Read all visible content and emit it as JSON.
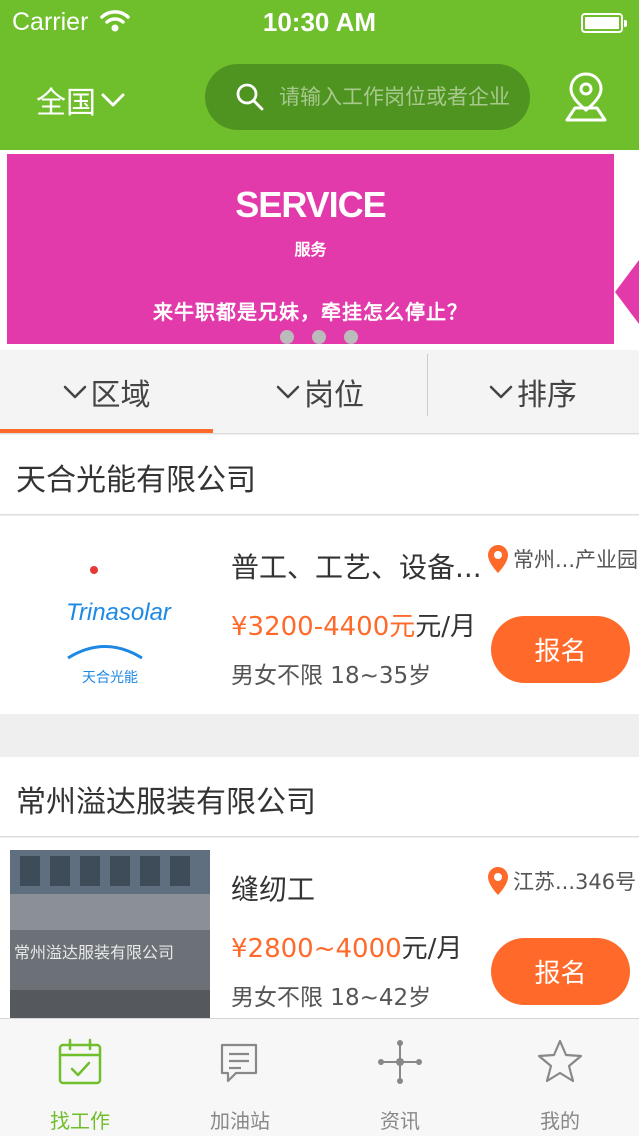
{
  "status_bar": {
    "carrier": "Carrier",
    "time": "10:30 AM"
  },
  "nav": {
    "region": "全国",
    "search_placeholder": "请输入工作岗位或者企业",
    "location_icon": "map-pin-icon"
  },
  "banner": {
    "title": "SERVICE",
    "subtitle": "服务",
    "slogan": "来牛职都是兄妹，牵挂怎么停止？",
    "color": "#e23aaa"
  },
  "filters": [
    {
      "label": "区域",
      "active": true
    },
    {
      "label": "岗位",
      "active": false
    },
    {
      "label": "排序",
      "active": false
    }
  ],
  "jobs": [
    {
      "company": "天合光能有限公司",
      "title": "普工、工艺、设备...",
      "salary": "¥3200-4400元",
      "salary_unit": "元/月",
      "salary_num": "¥3200-4400元",
      "requirement": "男女不限 18~35岁",
      "location": "常州...产业园",
      "apply_label": "报名",
      "logo_text": "Trinasolar",
      "logo_sub": "天合光能"
    },
    {
      "company": "常州溢达服装有限公司",
      "title": "缝纫工",
      "salary_num": "¥2800~4000",
      "salary_unit": "元/月",
      "requirement": "男女不限 18~42岁",
      "location": "江苏...346号",
      "apply_label": "报名",
      "logo_text": "常州溢达服装有限公司"
    }
  ],
  "tabbar": [
    {
      "label": "找工作",
      "icon": "calendar-check-icon",
      "active": true
    },
    {
      "label": "加油站",
      "icon": "message-edit-icon",
      "active": false
    },
    {
      "label": "资讯",
      "icon": "network-icon",
      "active": false
    },
    {
      "label": "我的",
      "icon": "star-icon",
      "active": false
    }
  ],
  "colors": {
    "primary": "#6fbe2b",
    "accent": "#ff6a2a"
  }
}
